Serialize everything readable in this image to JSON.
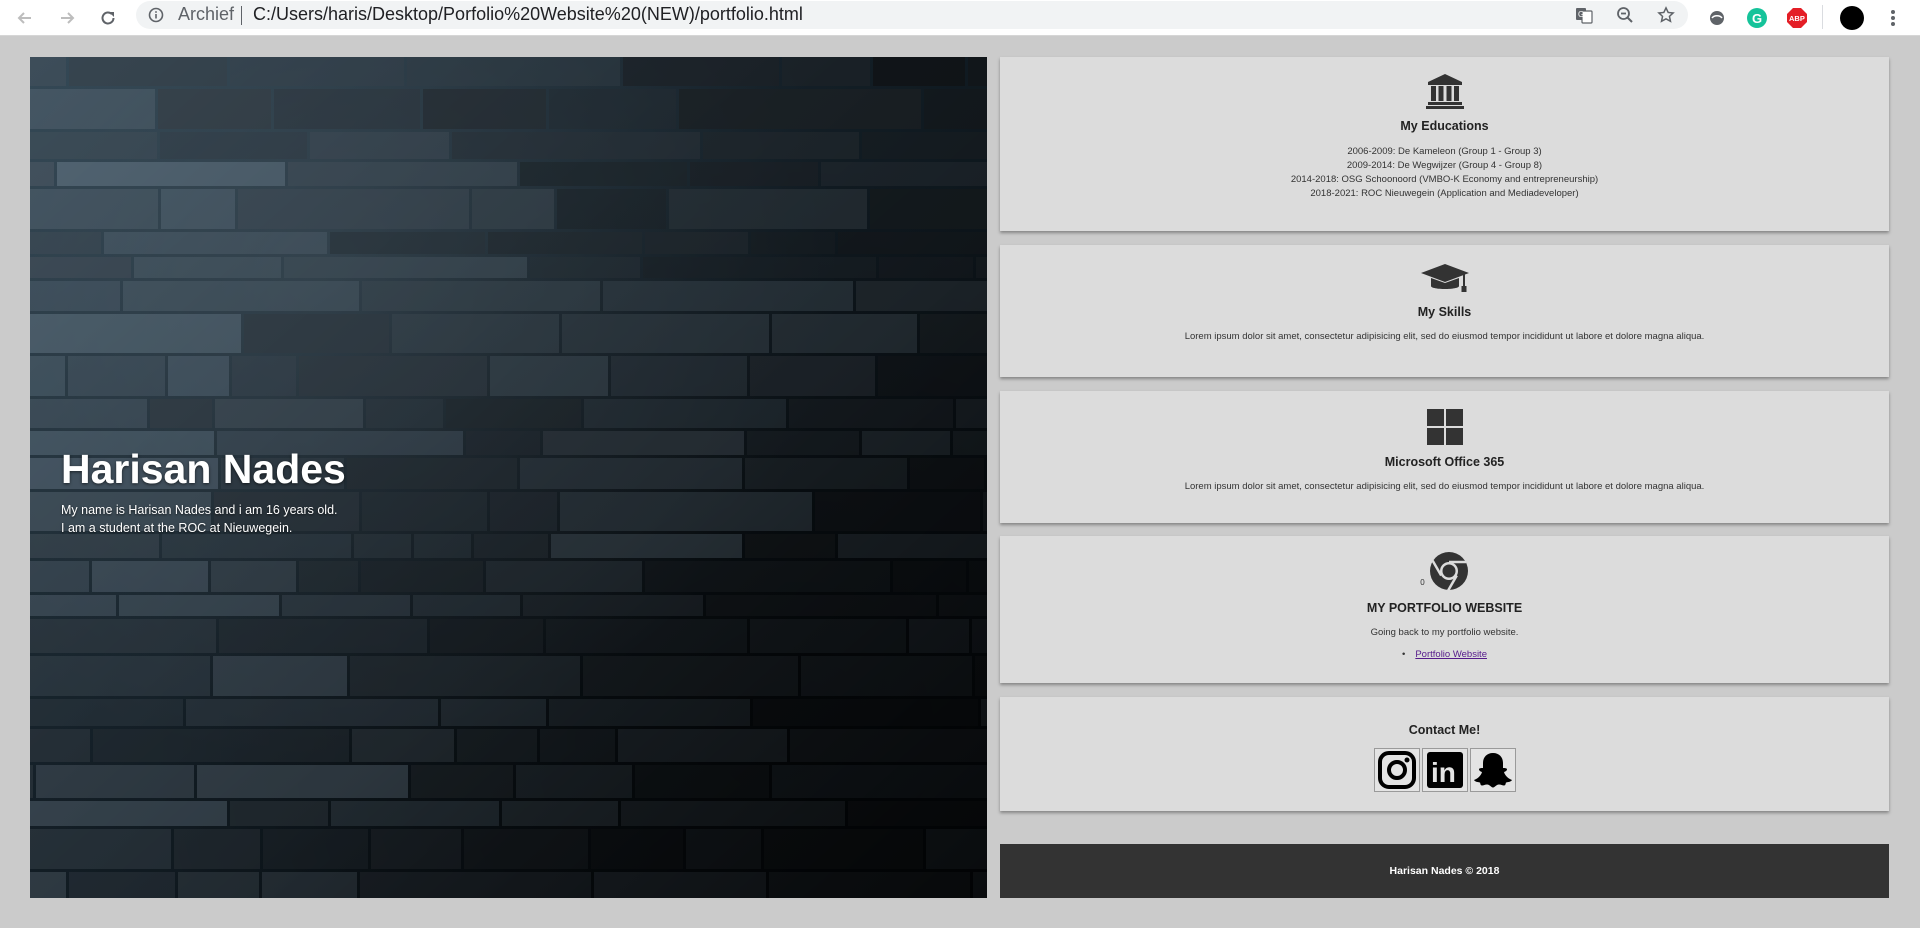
{
  "browser": {
    "omnibox_label": "Archief",
    "url": "C:/Users/haris/Desktop/Porfolio%20Website%20(NEW)/portfolio.html",
    "extensions": [
      "translate-icon",
      "zoom-out-icon",
      "star-icon",
      "vpn-icon",
      "grammarly-icon",
      "adblock-icon",
      "profile-avatar",
      "menu-icon"
    ],
    "abp_label": "ABP"
  },
  "hero": {
    "name": "Harisan Nades",
    "line1": "My name is Harisan Nades and i am 16 years old.",
    "line2": "I am a student at the ROC at Nieuwegein."
  },
  "education": {
    "icon": "institution-icon",
    "title": "My Educations",
    "lines": [
      "2006-2009: De Kameleon (Group 1 - Group 3)",
      "2009-2014: De Wegwijzer (Group 4 - Group 8)",
      "2014-2018: OSG Schoonoord (VMBO-K Economy and entrepreneurship)",
      "2018-2021: ROC Nieuwegein (Application and Mediadeveloper)"
    ]
  },
  "skills": {
    "icon": "graduation-cap-icon",
    "title": "My Skills",
    "text": "Lorem ipsum dolor sit amet, consectetur adipisicing elit, sed do eiusmod tempor incididunt ut labore et dolore magna aliqua."
  },
  "office": {
    "icon": "windows-icon",
    "title": "Microsoft Office 365",
    "text": "Lorem ipsum dolor sit amet, consectetur adipisicing elit, sed do eiusmod tempor incididunt ut labore et dolore magna aliqua."
  },
  "portfolio": {
    "icon": "chrome-icon",
    "icon_prefix": "0",
    "title": "MY PORTFOLIO WEBSITE",
    "text": "Going back to my portfolio website.",
    "link": "Portfolio Website"
  },
  "contact": {
    "title": "Contact Me!",
    "socials": [
      "instagram-icon",
      "linkedin-icon",
      "snapchat-icon"
    ],
    "linkedin_label": "in"
  },
  "footer": {
    "text": "Harisan Nades © 2018"
  },
  "colors": {
    "page_bg": "#cbcbcb",
    "card_bg": "#dcdcdc",
    "footer_bg": "#333333",
    "link": "#551a8b"
  }
}
